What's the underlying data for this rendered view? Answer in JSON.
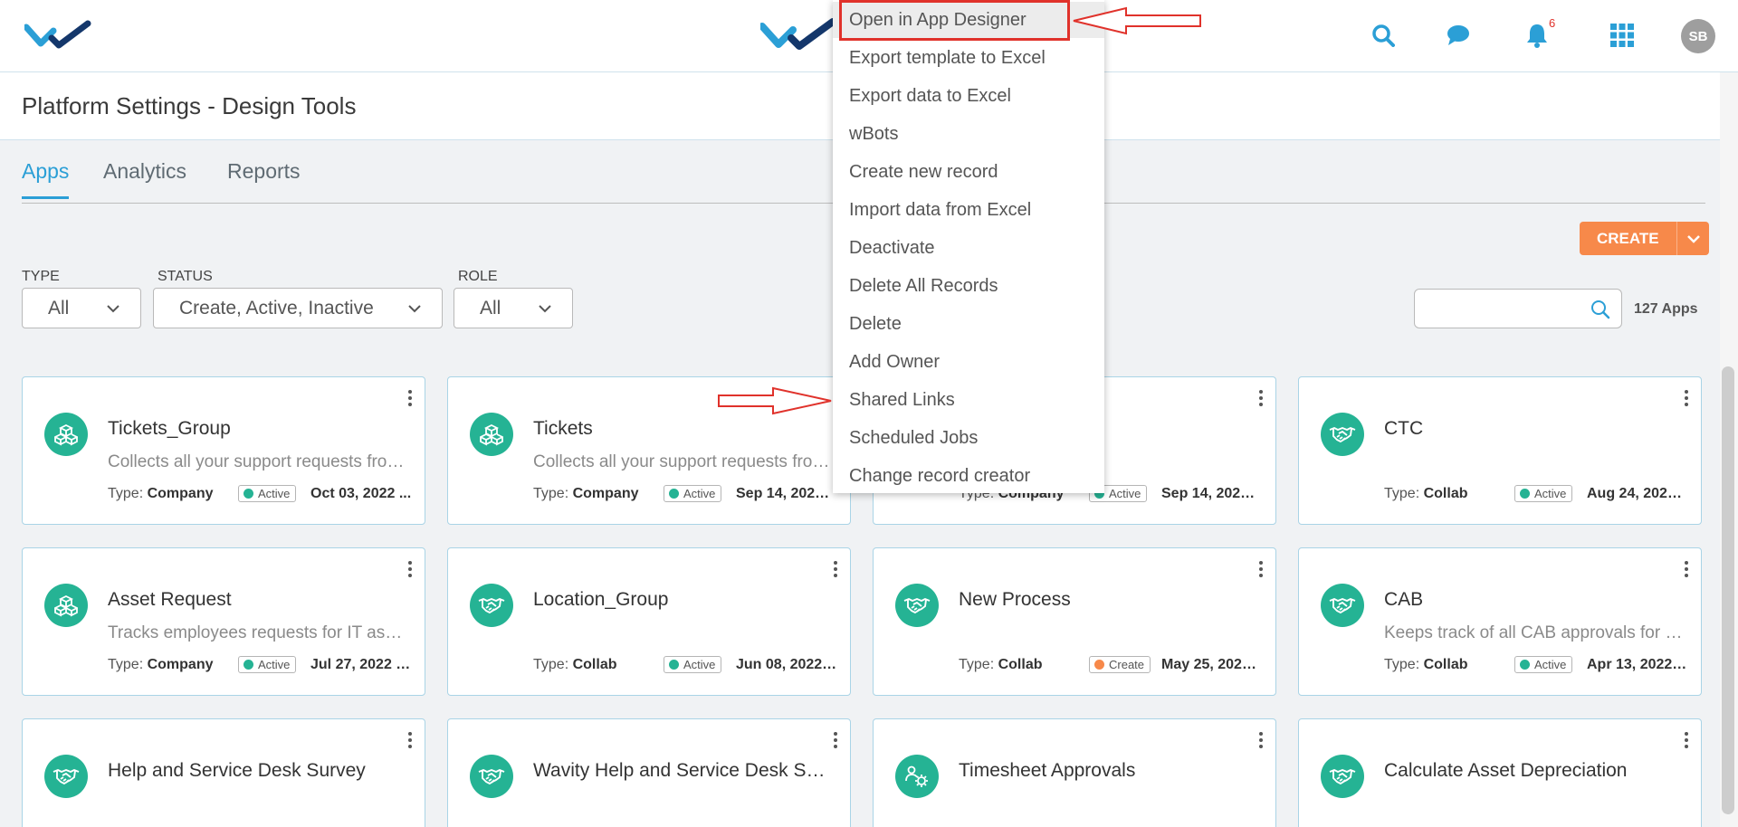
{
  "header": {
    "avatar_initials": "SB",
    "notification_count": "6",
    "icons": [
      "search-icon",
      "chat-icon",
      "bell-icon",
      "apps-grid-icon"
    ]
  },
  "page_title": "Platform Settings - Design Tools",
  "tabs": [
    {
      "label": "Apps",
      "active": true
    },
    {
      "label": "Analytics",
      "active": false
    },
    {
      "label": "Reports",
      "active": false
    }
  ],
  "create_button": {
    "label": "CREATE"
  },
  "filters": {
    "type": {
      "label": "TYPE",
      "value": "All"
    },
    "status": {
      "label": "STATUS",
      "value": "Create, Active, Inactive"
    },
    "role": {
      "label": "ROLE",
      "value": "All"
    }
  },
  "search": {
    "placeholder": "",
    "count_label": "127 Apps"
  },
  "context_menu": {
    "items": [
      "Open in App Designer",
      "Export template to Excel",
      "Export data to Excel",
      "wBots",
      "Create new record",
      "Import data from Excel",
      "Deactivate",
      "Delete All Records",
      "Delete",
      "Add Owner",
      "Shared Links",
      "Scheduled Jobs",
      "Change record creator"
    ],
    "highlighted_item": "Open in App Designer"
  },
  "meta_labels": {
    "type": "Type:"
  },
  "cards": [
    {
      "name": "Tickets_Group",
      "desc": "Collects all your support requests from your customers",
      "type": "Company",
      "status": "Active",
      "date": "Oct 03, 2022 ...",
      "icon": "cubes-icon"
    },
    {
      "name": "Tickets",
      "desc": "Collects all your support requests from your customers",
      "type": "Company",
      "status": "Active",
      "date": "Sep 14, 2022 ...",
      "icon": "cubes-icon"
    },
    {
      "name": "",
      "desc": "",
      "type": "Company",
      "status": "Active",
      "date": "Sep 14, 2022 ...",
      "icon": "handshake-icon"
    },
    {
      "name": "CTC",
      "desc": "",
      "type": "Collab",
      "status": "Active",
      "date": "Aug 24, 2022 02:...",
      "icon": "handshake-icon"
    },
    {
      "name": "Asset Request",
      "desc": "Tracks employees requests for IT assets",
      "type": "Company",
      "status": "Active",
      "date": "Jul 27, 2022 0...",
      "icon": "cubes-icon"
    },
    {
      "name": "Location_Group",
      "desc": "",
      "type": "Collab",
      "status": "Active",
      "date": "Jun 08, 2022 12:...",
      "icon": "handshake-icon"
    },
    {
      "name": "New Process",
      "desc": "",
      "type": "Collab",
      "status": "Create",
      "date": "May 25, 2022 08...",
      "icon": "handshake-icon"
    },
    {
      "name": "CAB",
      "desc": "Keeps track of all CAB approvals for changes",
      "type": "Collab",
      "status": "Active",
      "date": "Apr 13, 2022 10:...",
      "icon": "handshake-icon"
    },
    {
      "name": "Help and Service Desk Survey",
      "desc": "",
      "type": "",
      "status": "",
      "date": "",
      "icon": "handshake-icon"
    },
    {
      "name": "Wavity Help and Service Desk Survey",
      "desc": "",
      "type": "",
      "status": "",
      "date": "",
      "icon": "handshake-icon"
    },
    {
      "name": "Timesheet Approvals",
      "desc": "",
      "type": "",
      "status": "",
      "date": "",
      "icon": "people-gear-icon"
    },
    {
      "name": "Calculate Asset Depreciation",
      "desc": "",
      "type": "",
      "status": "",
      "date": "",
      "icon": "handshake-icon"
    }
  ],
  "colors": {
    "accent": "#2b9fd6",
    "create_button": "#f7894a",
    "card_icon_bg": "#25b394",
    "status_active": "#25b394",
    "status_create": "#f7894a",
    "annotation_red": "#e0322b"
  }
}
